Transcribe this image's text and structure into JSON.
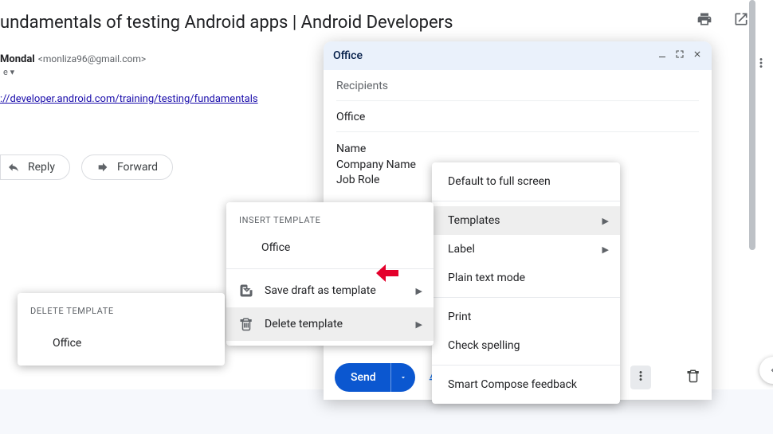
{
  "page": {
    "title": "undamentals of testing Android apps  |  Android Developers"
  },
  "email": {
    "from_name": "Mondal",
    "from_email": "<monliza96@gmail.com>",
    "to_indicator": "e",
    "body_link_text": "://developer.android.com/training/testing/fundamentals",
    "reply_label": "Reply",
    "forward_label": "Forward"
  },
  "compose": {
    "title": "Office",
    "recipients_placeholder": "Recipients",
    "subject": "Office",
    "body_line1": "Name",
    "body_line2": "Company Name",
    "body_line3": "Job Role",
    "send_label": "Send"
  },
  "more_menu": {
    "default_fullscreen": "Default to full screen",
    "templates": "Templates",
    "label": "Label",
    "plain_text": "Plain text mode",
    "print": "Print",
    "check_spelling": "Check spelling",
    "smart_compose": "Smart Compose feedback"
  },
  "templates_menu": {
    "insert_header": "INSERT TEMPLATE",
    "template_name": "Office",
    "save_draft": "Save draft as template",
    "delete_template": "Delete template"
  },
  "delete_menu": {
    "header": "DELETE TEMPLATE",
    "template_name": "Office"
  }
}
